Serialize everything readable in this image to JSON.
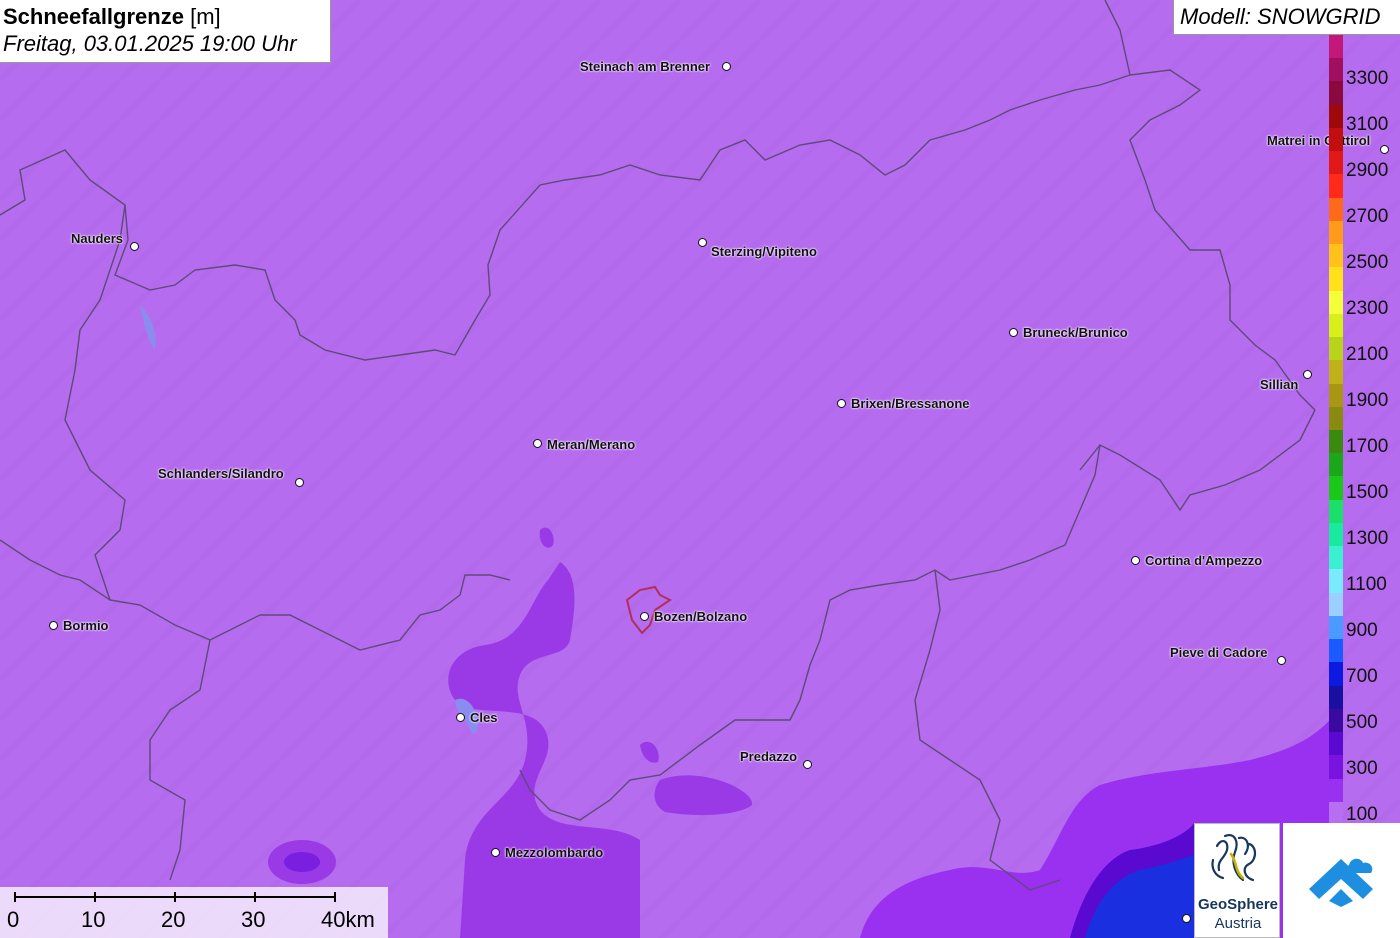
{
  "title": {
    "bold": "Schneefallgrenze",
    "unit": "[m]",
    "datetime": "Freitag, 03.01.2025 19:00 Uhr"
  },
  "model": "Modell: SNOWGRID",
  "legend": {
    "labels": [
      "3300",
      "3100",
      "2900",
      "2700",
      "2500",
      "2300",
      "2100",
      "1900",
      "1700",
      "1500",
      "1300",
      "1100",
      "900",
      "700",
      "500",
      "300",
      "100"
    ],
    "colors": [
      "#c2187a",
      "#a0105e",
      "#8a0a40",
      "#9e0a0a",
      "#c20e0e",
      "#e01818",
      "#ff2a1a",
      "#ff6a1a",
      "#ff9a1a",
      "#ffc21a",
      "#ffe01a",
      "#f4ff3a",
      "#d8f01a",
      "#b8d41a",
      "#c0b01a",
      "#a89614",
      "#8a8a10",
      "#3a8a10",
      "#1aa81a",
      "#1ac81a",
      "#1ae06a",
      "#1aeaa0",
      "#3af0d0",
      "#7aeaff",
      "#9ad0ff",
      "#4a9aff",
      "#1a5aff",
      "#0a1ae0",
      "#1a10a0",
      "#3a0aa0",
      "#5a0ad0",
      "#7a12e0",
      "#9a30f0",
      "#b76ef0"
    ]
  },
  "cities": [
    {
      "name": "Steinach am Brenner"
    },
    {
      "name": "Matrei in Osttirol"
    },
    {
      "name": "Nauders"
    },
    {
      "name": "Sterzing/Vipiteno"
    },
    {
      "name": "Bruneck/Brunico"
    },
    {
      "name": "Sillian"
    },
    {
      "name": "Brixen/Bressanone"
    },
    {
      "name": "Meran/Merano"
    },
    {
      "name": "Schlanders/Silandro"
    },
    {
      "name": "Cortina d'Ampezzo"
    },
    {
      "name": "Bormio"
    },
    {
      "name": "Bozen/Bolzano"
    },
    {
      "name": "Pieve di Cadore"
    },
    {
      "name": "Cles"
    },
    {
      "name": "Predazzo"
    },
    {
      "name": "Mezzolombardo"
    }
  ],
  "scale": {
    "labels": [
      "0",
      "10",
      "20",
      "30",
      "40km"
    ]
  },
  "logo": {
    "name": "GeoSphere",
    "sub": "Austria"
  },
  "icons": [
    "geosphere-logo-icon",
    "app-logo-icon"
  ]
}
